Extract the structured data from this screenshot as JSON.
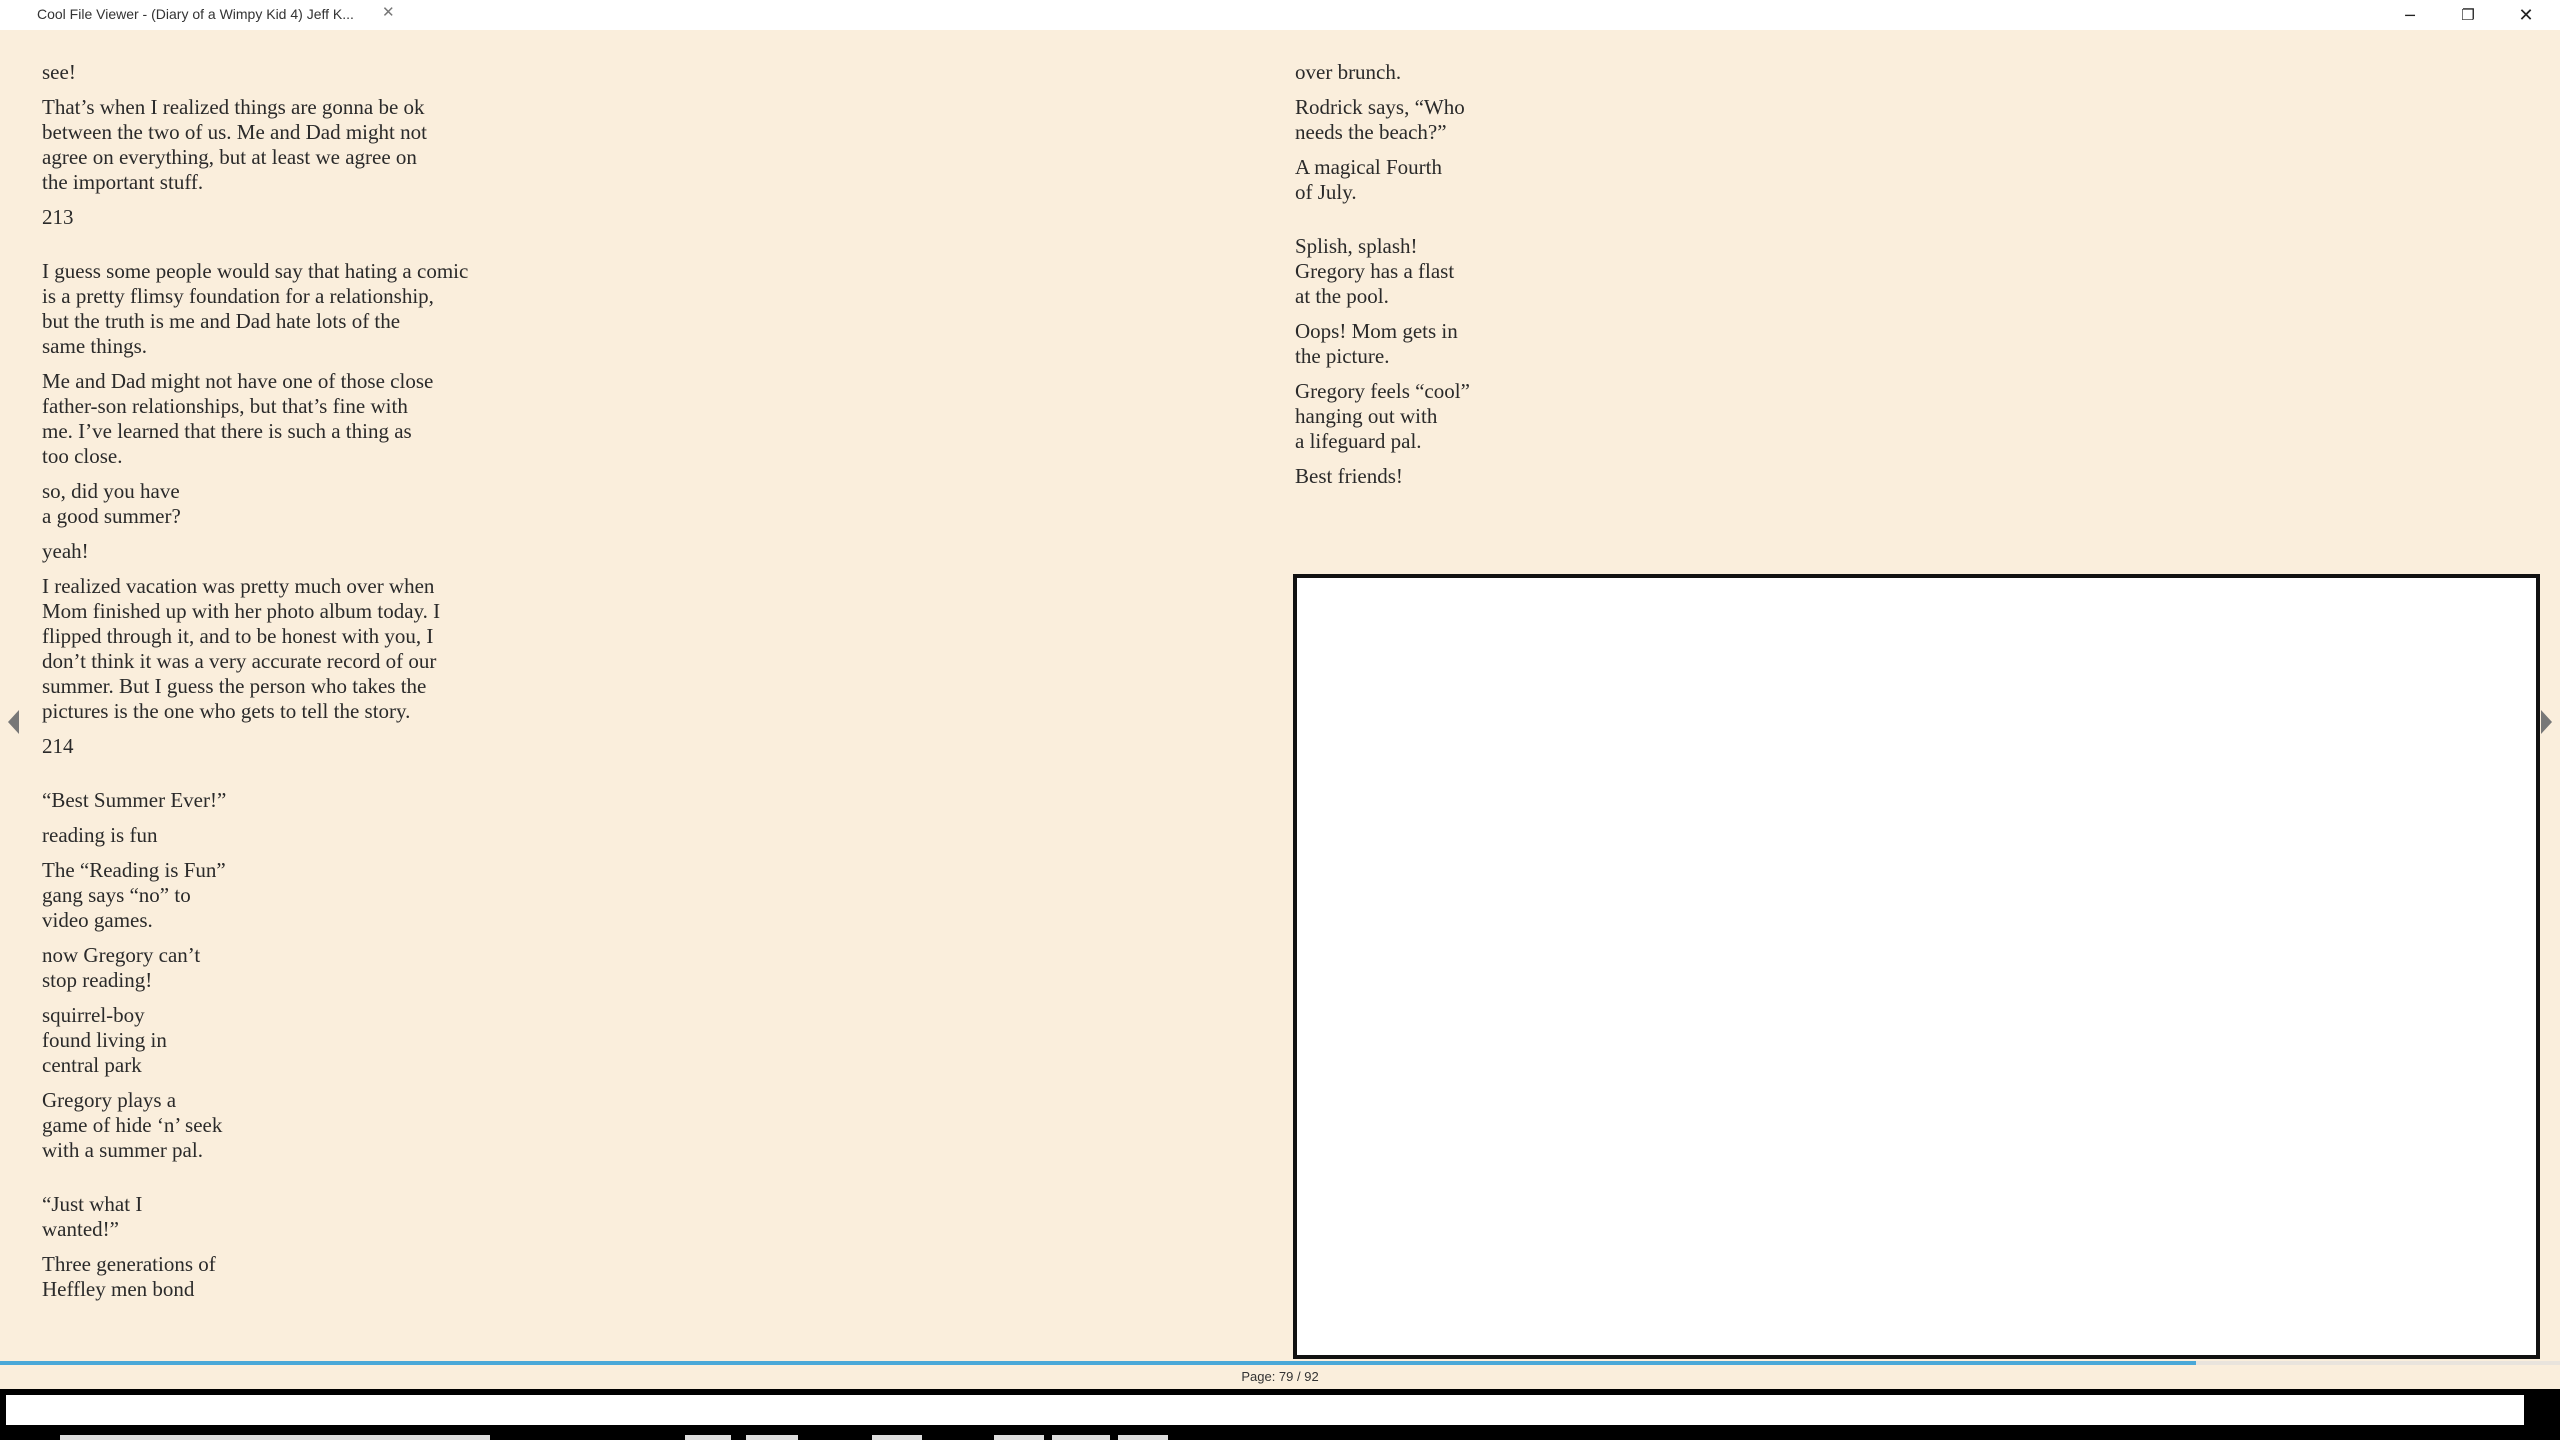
{
  "window": {
    "title": "Cool File Viewer - (Diary of a Wimpy Kid 4) Jeff K...",
    "tab_close_glyph": "✕",
    "minimize_glyph": "─",
    "restore_glyph": "❐",
    "close_glyph": "✕"
  },
  "left_column": [
    "see!",
    "That’s when I realized things are gonna be ok\nbetween the two of us. Me and Dad might not\nagree on everything, but at least we agree on\nthe important stuff.",
    "213",
    "I guess some people would say that hating a comic\nis a pretty flimsy foundation for a relationship,\nbut the truth is me and Dad hate lots of the\nsame things.",
    "Me and Dad might not have one of those close\nfather-son relationships, but that’s fine with\nme. I’ve learned that there is such a thing as\ntoo close.",
    "so, did you have\na good summer?",
    "yeah!",
    "I realized vacation was pretty much over when\nMom finished up with her photo album today. I\nflipped through it, and to be honest with you, I\ndon’t think it was a very accurate record of our\nsummer. But I guess the person who takes the\npictures is the one who gets to tell the story.",
    "214",
    "“Best Summer Ever!”",
    "reading is fun",
    "The “Reading is Fun”\ngang says “no” to\nvideo games.",
    "now Gregory can’t\nstop reading!",
    "squirrel-boy\nfound living in\ncentral park",
    "Gregory plays a\ngame of hide ‘n’ seek\nwith a summer pal.",
    "“Just what I\nwanted!”",
    "Three generations of\nHeffley men bond"
  ],
  "right_column": [
    "over brunch.",
    "Rodrick says, “Who\nneeds the beach?”",
    "A magical Fourth\nof July.",
    "Splish, splash!\nGregory has a flast\nat the pool.",
    "Oops! Mom gets in\nthe picture.",
    "Gregory feels “cool”\nhanging out with\na lifeguard pal.",
    "Best friends!"
  ],
  "reader": {
    "page_label": "Page: 79 / 92",
    "current_page": 79,
    "total_pages": 92,
    "progress_fraction": 0.858
  },
  "colors": {
    "background": "#faeedc",
    "progress": "#4aa8d8",
    "text": "#2a2a2a"
  },
  "icons": {
    "prev": "triangle-left-icon",
    "next": "triangle-right-icon"
  }
}
